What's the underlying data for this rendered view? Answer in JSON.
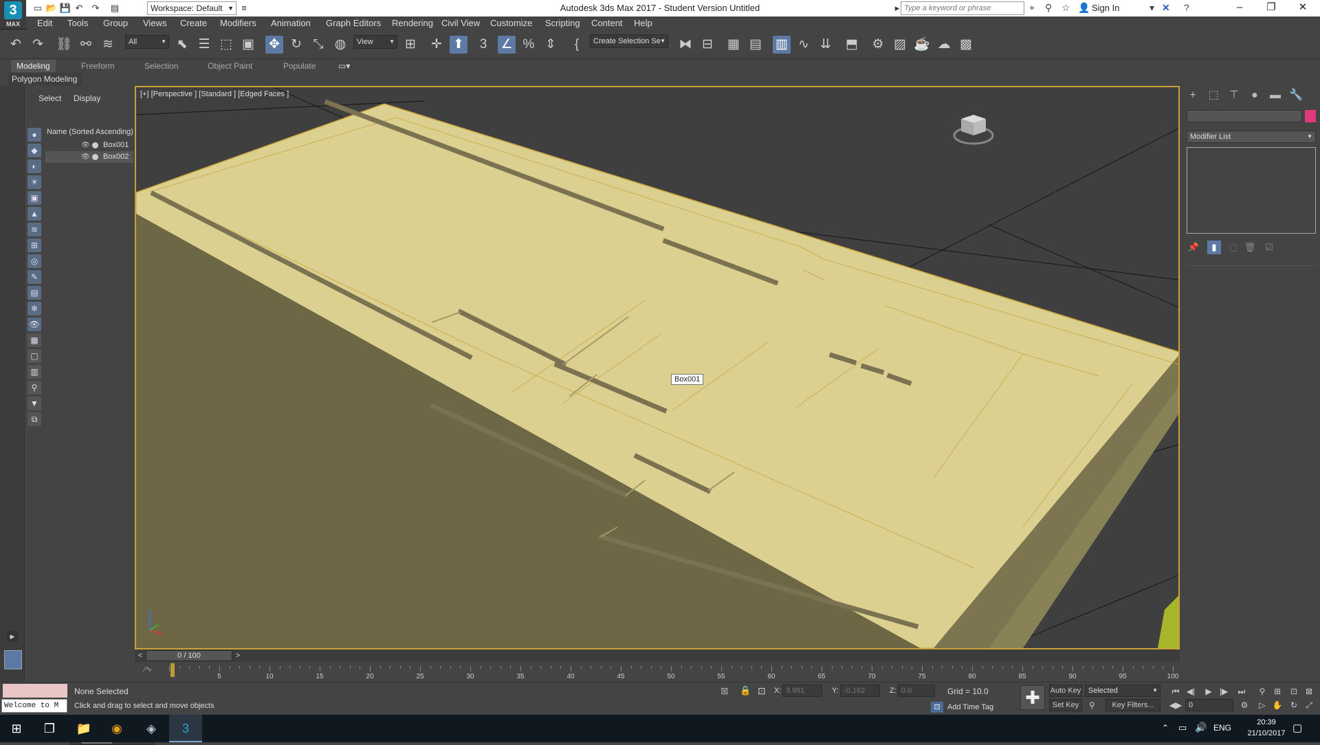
{
  "titlebar": {
    "app_logo": "3",
    "app_logo_sub": "MAX",
    "workspace": "Workspace: Default",
    "title": "Autodesk 3ds Max 2017 - Student Version     Untitled",
    "search_placeholder": "Type a keyword or phrase",
    "signin": "Sign In"
  },
  "menu": [
    "Edit",
    "Tools",
    "Group",
    "Views",
    "Create",
    "Modifiers",
    "Animation",
    "Graph Editors",
    "Rendering",
    "Civil View",
    "Customize",
    "Scripting",
    "Content",
    "Help"
  ],
  "toolbar": {
    "filter": "All",
    "ref_coord": "View",
    "selection_set": "Create Selection Se"
  },
  "ribbon": {
    "tabs": [
      "Modeling",
      "Freeform",
      "Selection",
      "Object Paint",
      "Populate"
    ],
    "active_tab": "Modeling",
    "panel": "Polygon Modeling"
  },
  "explorer": {
    "tabs": [
      "Select",
      "Display"
    ],
    "header": "Name (Sorted Ascending)",
    "items": [
      "Box001",
      "Box002"
    ]
  },
  "viewport": {
    "label": "[+] [Perspective ] [Standard ] [Edged Faces ]",
    "tooltip": "Box001",
    "object_color": "#dbd08f",
    "selection_border": "#c9a23a"
  },
  "command_panel": {
    "modifier_list": "Modifier List",
    "object_color": "#e0397f"
  },
  "timeline": {
    "frame": "0 / 100",
    "ticks": [
      "5",
      "10",
      "15",
      "20",
      "25",
      "30",
      "35",
      "40",
      "45",
      "50",
      "55",
      "60",
      "65",
      "70",
      "75",
      "80",
      "85",
      "90",
      "95",
      "100"
    ]
  },
  "status": {
    "maxscript": "Welcome to M",
    "selection": "None Selected",
    "prompt": "Click and drag to select and move objects",
    "x": "3.991",
    "y": "-0.162",
    "z": "0.0",
    "grid": "Grid = 10.0",
    "add_time_tag": "Add Time Tag",
    "auto_key": "Auto Key",
    "set_key": "Set Key",
    "key_mode": "Selected",
    "key_filters": "Key Filters...",
    "current_frame": "0"
  },
  "taskbar": {
    "lang": "ENG",
    "time": "20:39",
    "date": "21/10/2017"
  }
}
